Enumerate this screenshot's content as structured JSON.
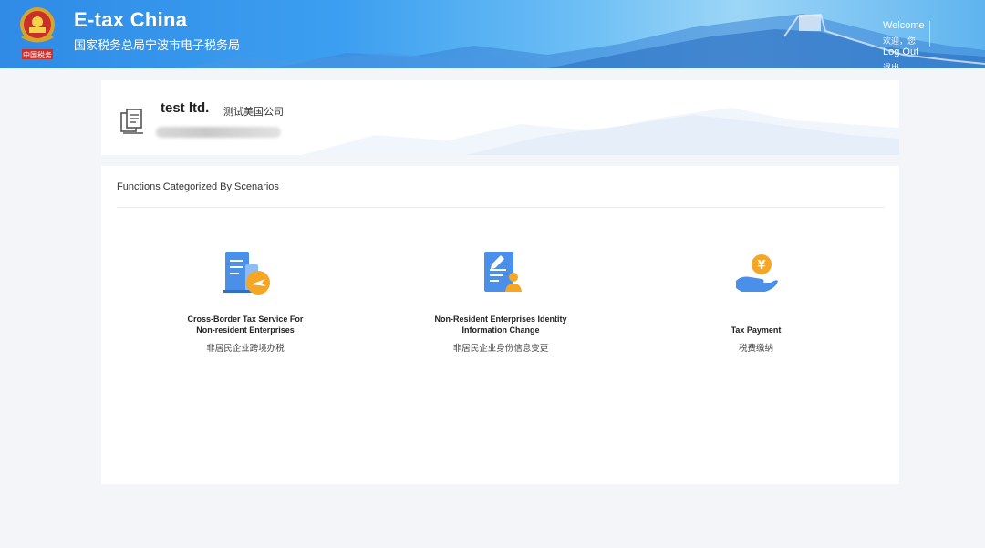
{
  "header": {
    "title": "E-tax China",
    "subtitle": "国家税务总局宁波市电子税务局",
    "welcome_en": "Welcome",
    "welcome_cn": "欢迎，您",
    "logout_en": "Log Out",
    "logout_cn": "退出"
  },
  "company": {
    "name": "test ltd.",
    "name_cn": "测试美国公司",
    "icon": "company-document-icon"
  },
  "functions": {
    "title": "Functions Categorized By Scenarios",
    "items": [
      {
        "title_en_line1": "Cross-Border Tax Service For",
        "title_en_line2": "Non-resident Enterprises",
        "title_cn": "非居民企业跨境办税",
        "icon": "cross-border-document-plane-icon"
      },
      {
        "title_en_line1": "Non-Resident Enterprises Identity",
        "title_en_line2": "Information Change",
        "title_cn": "非居民企业身份信息变更",
        "icon": "identity-document-person-icon"
      },
      {
        "title_en_line1": "",
        "title_en_line2": "Tax Payment",
        "title_cn": "税费缴纳",
        "icon": "hand-coin-yuan-icon"
      }
    ]
  },
  "colors": {
    "header_blue": "#2f8be6",
    "accent_orange": "#f5a623",
    "icon_blue": "#3d8ee8"
  }
}
